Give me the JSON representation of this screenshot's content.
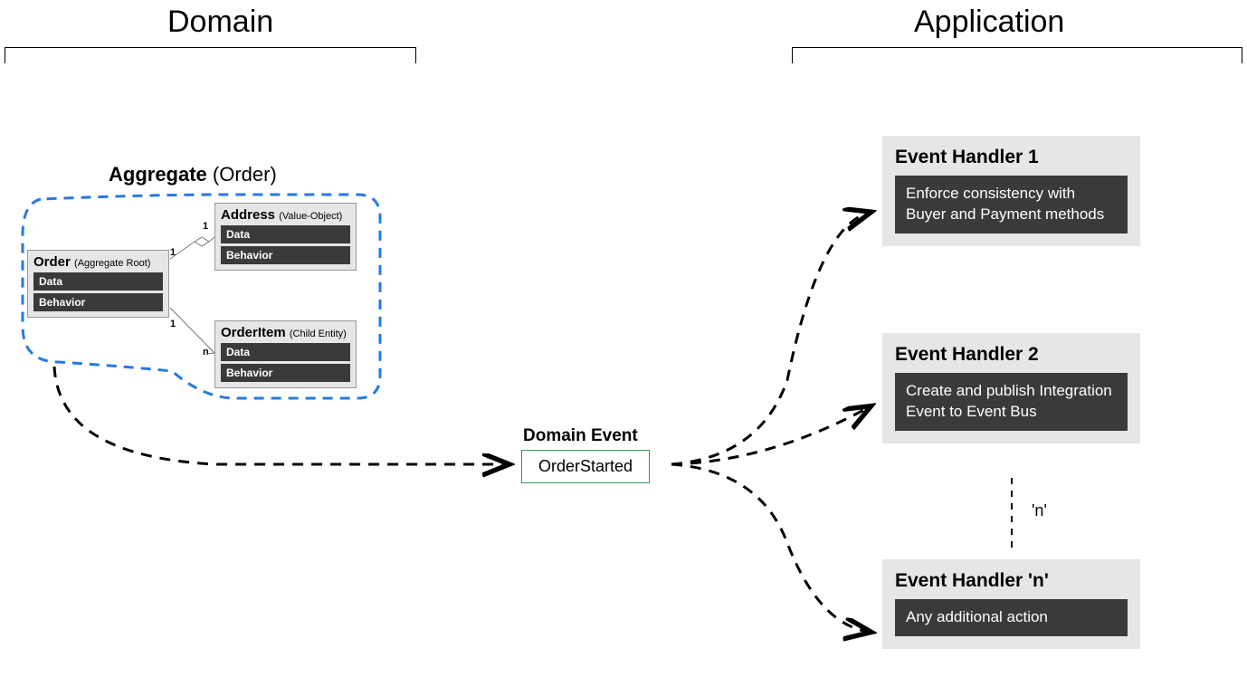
{
  "sections": {
    "domain": "Domain",
    "application": "Application"
  },
  "aggregate": {
    "label_bold": "Aggregate",
    "label_paren": "(Order)"
  },
  "entities": {
    "order": {
      "name": "Order",
      "stereo": "(Aggregate Root)",
      "rows": [
        "Data",
        "Behavior"
      ]
    },
    "address": {
      "name": "Address",
      "stereo": "(Value-Object)",
      "rows": [
        "Data",
        "Behavior"
      ]
    },
    "orderitem": {
      "name": "OrderItem",
      "stereo": "(Child Entity)",
      "rows": [
        "Data",
        "Behavior"
      ]
    }
  },
  "mult": {
    "one": "1",
    "n": "n"
  },
  "domain_event": {
    "label": "Domain Event",
    "name": "OrderStarted"
  },
  "handlers": {
    "h1": {
      "title": "Event Handler 1",
      "desc": "Enforce consistency with Buyer and Payment methods"
    },
    "h2": {
      "title": "Event Handler 2",
      "desc": "Create and publish Integration Event to Event Bus"
    },
    "hn": {
      "title": "Event Handler 'n'",
      "desc": "Any additional action"
    }
  },
  "n_connector": "'n'"
}
